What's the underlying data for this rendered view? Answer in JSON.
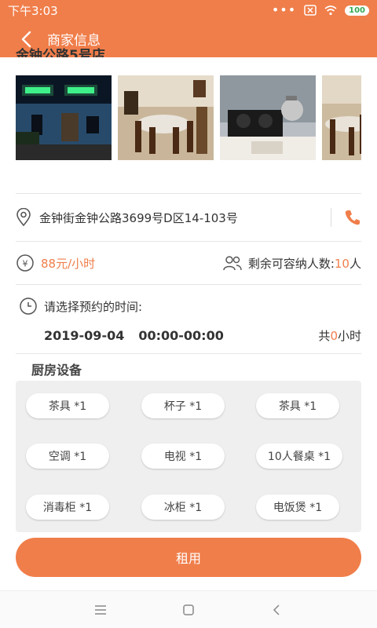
{
  "status_bar": {
    "time": "下午3:03",
    "battery": "100"
  },
  "header": {
    "title": "商家信息"
  },
  "store": {
    "name_cut": "金钟公路5号店"
  },
  "address": {
    "text": "金钟街金钟公路3699号D区14-103号"
  },
  "pricing": {
    "currency_symbol": "¥",
    "price": "88元/小时",
    "capacity_label": "剩余可容纳人数:",
    "capacity_value": "10",
    "capacity_unit": "人"
  },
  "booking": {
    "prompt": "请选择预约的时间:",
    "date": "2019-09-04",
    "time_range": "00:00-00:00",
    "total_prefix": "共",
    "total_value": "0",
    "total_unit": "小时"
  },
  "equipment": {
    "title": "厨房设备",
    "items": [
      "茶具 *1",
      "杯子 *1",
      "茶具 *1",
      "空调 *1",
      "电视 *1",
      "10人餐桌 *1",
      "消毒柜 *1",
      "冰柜 *1",
      "电饭煲 *1"
    ]
  },
  "actions": {
    "rent_label": "租用"
  },
  "colors": {
    "accent": "#f07e4a"
  }
}
